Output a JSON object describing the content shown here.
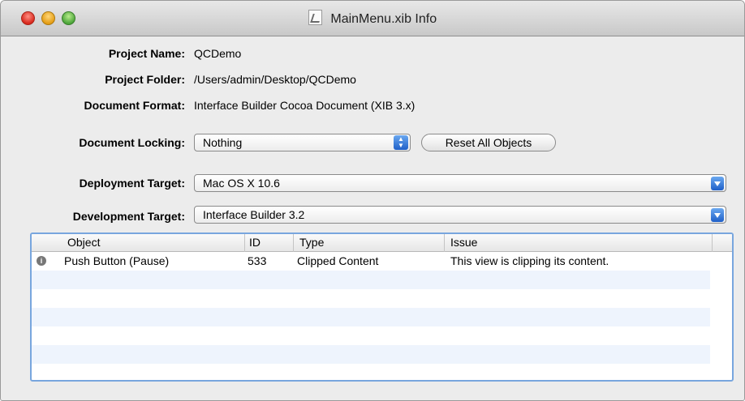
{
  "window": {
    "title": "MainMenu.xib Info"
  },
  "fields": {
    "project_name_label": "Project Name:",
    "project_name_value": "QCDemo",
    "project_folder_label": "Project Folder:",
    "project_folder_value": "/Users/admin/Desktop/QCDemo",
    "document_format_label": "Document Format:",
    "document_format_value": "Interface Builder Cocoa Document (XIB 3.x)",
    "document_locking_label": "Document Locking:",
    "document_locking_value": "Nothing",
    "reset_button_label": "Reset All Objects",
    "deployment_target_label": "Deployment Target:",
    "deployment_target_value": "Mac OS X 10.6",
    "development_target_label": "Development Target:",
    "development_target_value": "Interface Builder 3.2"
  },
  "table": {
    "columns": [
      "Object",
      "ID",
      "Type",
      "Issue"
    ],
    "rows": [
      {
        "object": "Push Button (Pause)",
        "id": "533",
        "type": "Clipped Content",
        "issue": "This view is clipping its content.",
        "icon": "info-icon"
      }
    ]
  },
  "colors": {
    "accent": "#2f6fd6",
    "table_focus": "#78a6de",
    "alt_row": "#eef4fd"
  }
}
